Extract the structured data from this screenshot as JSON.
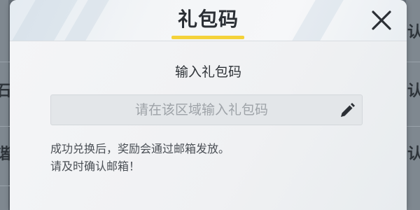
{
  "dialog": {
    "title": "礼包码",
    "input_label": "输入礼包码",
    "input": {
      "value": "",
      "placeholder": "请在该区域输入礼包码"
    },
    "notice_lines": [
      "成功兑换后，奖励会通过邮箱发放。",
      "请及时确认邮箱！"
    ],
    "icons": {
      "close": "close-icon",
      "edit": "pencil-icon"
    }
  },
  "background": {
    "left_chars": [
      "石",
      "谐"
    ],
    "right_chars": [
      "认",
      "认",
      "认"
    ]
  },
  "colors": {
    "title_underline": "#f4d23a",
    "dialog_bg": "#f2f3f5",
    "input_bg": "#e3e6e9"
  }
}
